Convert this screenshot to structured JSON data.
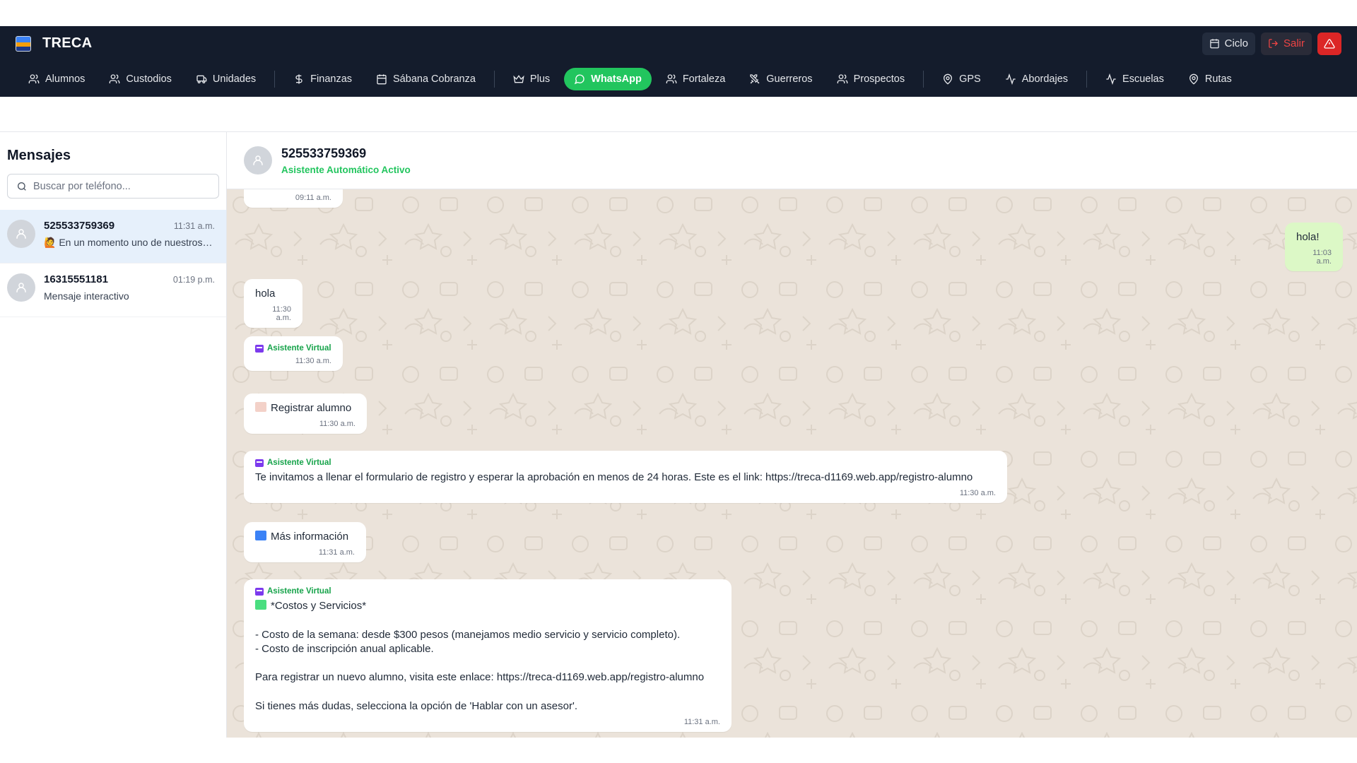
{
  "app": {
    "title": "TRECA"
  },
  "header": {
    "ciclo_label": "Ciclo",
    "salir_label": "Salir"
  },
  "nav": {
    "items": [
      {
        "label": "Alumnos",
        "icon": "users-icon"
      },
      {
        "label": "Custodios",
        "icon": "users-icon"
      },
      {
        "label": "Unidades",
        "icon": "bus-icon"
      },
      {
        "label": "Finanzas",
        "icon": "dollar-icon"
      },
      {
        "label": "Sábana Cobranza",
        "icon": "calendar-icon"
      },
      {
        "label": "Plus",
        "icon": "crown-icon"
      },
      {
        "label": "WhatsApp",
        "icon": "chat-icon",
        "active": true
      },
      {
        "label": "Fortaleza",
        "icon": "users-icon"
      },
      {
        "label": "Guerreros",
        "icon": "swords-icon"
      },
      {
        "label": "Prospectos",
        "icon": "users-icon"
      },
      {
        "label": "GPS",
        "icon": "pin-icon"
      },
      {
        "label": "Abordajes",
        "icon": "activity-icon"
      },
      {
        "label": "Escuelas",
        "icon": "activity-icon"
      },
      {
        "label": "Rutas",
        "icon": "pin-icon"
      }
    ]
  },
  "sidebar": {
    "title": "Mensajes",
    "search_placeholder": "Buscar por teléfono...",
    "conversations": [
      {
        "name": "525533759369",
        "time": "11:31 a.m.",
        "preview": "🙋 En un momento uno de nuestros asesores te atenderá"
      },
      {
        "name": "16315551181",
        "time": "01:19 p.m.",
        "preview": "Mensaje interactivo"
      }
    ]
  },
  "chat": {
    "name": "525533759369",
    "status": "Asistente Automático Activo",
    "agent_label": "Asistente Virtual",
    "messages": [
      {
        "time": "09:11 a.m."
      },
      {
        "text": "hola!",
        "time": "11:03 a.m."
      },
      {
        "text": "hola",
        "time": "11:30 a.m."
      },
      {
        "time": "11:30 a.m."
      },
      {
        "text": "Registrar alumno",
        "time": "11:30 a.m."
      },
      {
        "text": "Te invitamos a llenar el formulario de registro y esperar la aprobación en menos de 24 horas. Este es el link: https://treca-d1169.web.app/registro-alumno",
        "time": "11:30 a.m."
      },
      {
        "text": "Más información",
        "time": "11:31 a.m."
      },
      {
        "text": "*Costos y Servicios*\n\n- Costo de la semana: desde $300 pesos (manejamos medio servicio y servicio completo).\n- Costo de inscripción anual aplicable.\n\nPara registrar un nuevo alumno, visita este enlace: https://treca-d1169.web.app/registro-alumno\n\nSi tienes más dudas, selecciona la opción de 'Hablar con un asesor'.",
        "time": "11:31 a.m."
      }
    ]
  },
  "colors": {
    "nav_bg": "#141c2c",
    "accent": "#22c55e",
    "chat_bg": "#ebe3da",
    "danger": "#dc2626"
  }
}
